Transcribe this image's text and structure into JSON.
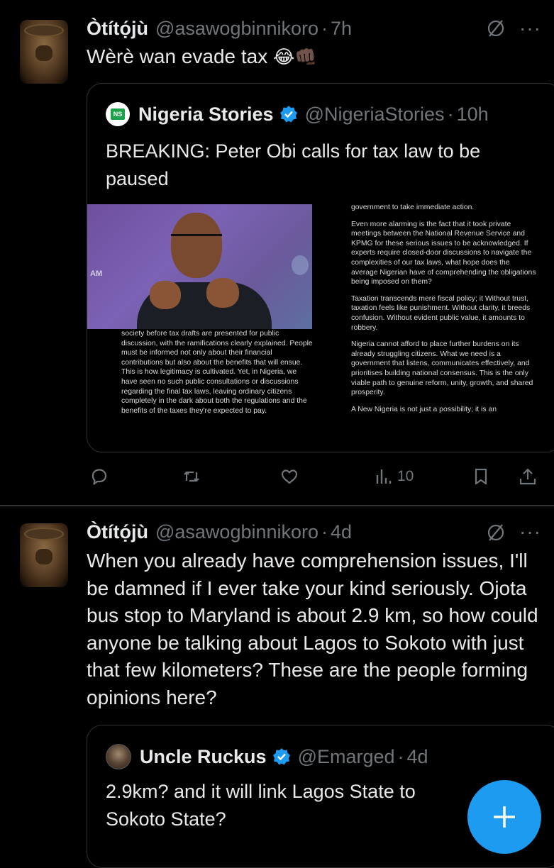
{
  "tweets": [
    {
      "author_name": "Òtítọ́jù",
      "author_handle": "@asawogbinnikoro",
      "separator": "·",
      "time": "7h",
      "text": "Wèrè wan evade tax",
      "emojis": "😂👊🏿",
      "quote": {
        "author_name": "Nigeria Stories",
        "author_handle": "@NigeriaStories",
        "time": "10h",
        "text": "BREAKING: Peter Obi calls for tax law to be paused",
        "photo_backdrop_text": "AM",
        "document_left": [
          "society before tax drafts are presented for public discussion, with the ramifications clearly explained. People must be informed not only about their financial contributions but also about the benefits that will ensue. This is how legitimacy is cultivated. Yet, in Nigeria, we have seen no such public consultations or discussions regarding the final tax laws, leaving ordinary citizens completely in the dark about both the regulations and the benefits of the taxes they're expected to pay."
        ],
        "document_right": [
          "government to take immediate action.",
          "Even more alarming is the fact that it took private meetings between the National Revenue Service and KPMG for these serious issues to be acknowledged. If experts require closed-door discussions to navigate the complexities of our tax laws, what hope does the average Nigerian have of comprehending the obligations being imposed on them?",
          "Taxation transcends mere fiscal policy; it Without trust, taxation feels like punishment. Without clarity, it breeds confusion. Without evident public value, it amounts to robbery.",
          "Nigeria cannot afford to place further burdens on its already struggling citizens. What we need is a government that listens, communicates effectively, and prioritises building national consensus. This is the only viable path to genuine reform, unity, growth, and shared prosperity.",
          "A New Nigeria is not just a possibility; it is an"
        ]
      },
      "views": "10"
    },
    {
      "author_name": "Òtítọ́jù",
      "author_handle": "@asawogbinnikoro",
      "separator": "·",
      "time": "4d",
      "text": "When you already have comprehension issues, I'll be damned if I ever take your kind seriously. Ojota bus stop to Maryland is about 2.9 km, so how could anyone be talking about Lagos to Sokoto with just that few kilometers? These are the people forming opinions here?",
      "quote": {
        "author_name": "Uncle Ruckus",
        "author_handle": "@Emarged",
        "time": "4d",
        "text": "2.9km? and it will link Lagos State to Sokoto State?"
      }
    }
  ],
  "more_glyph": "···",
  "colors": {
    "background": "#000000",
    "text": "#e7e9ea",
    "secondary": "#71767b",
    "accent": "#1d9bf0",
    "border": "#2f3336"
  },
  "icons": [
    "mute-icon",
    "more-icon",
    "verified-icon",
    "reply-icon",
    "retweet-icon",
    "like-icon",
    "views-icon",
    "bookmark-icon",
    "share-icon",
    "compose-plus-icon"
  ]
}
